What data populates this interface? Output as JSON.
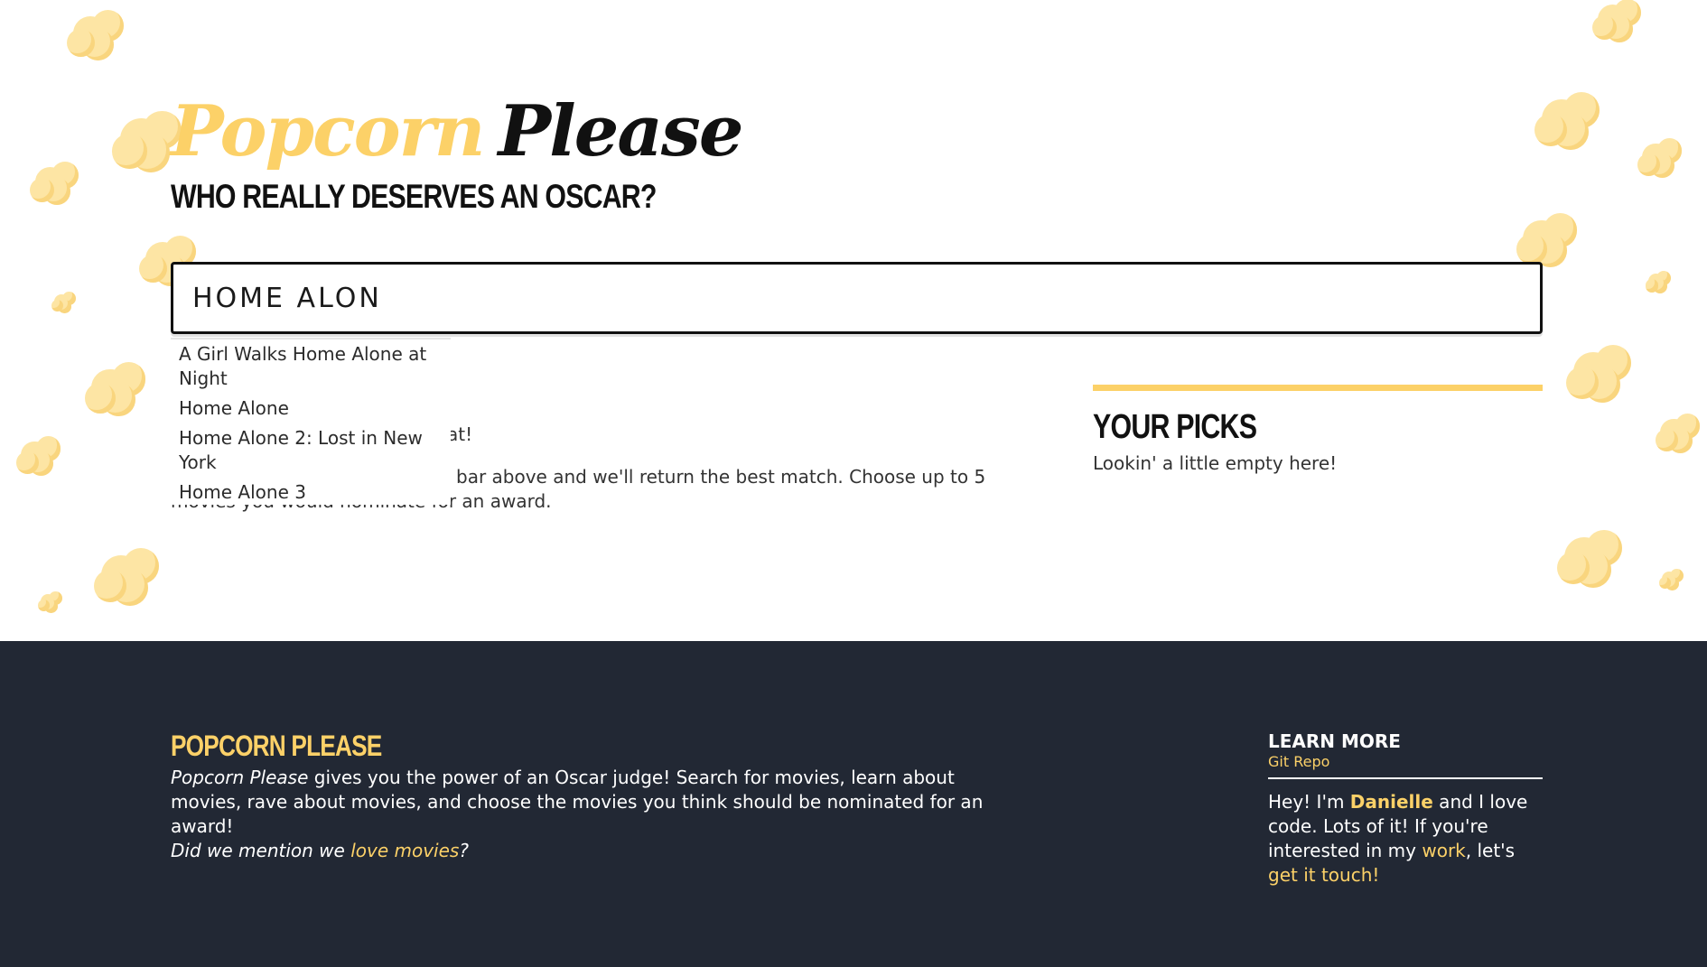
{
  "colors": {
    "accent": "#fcd168",
    "text_dark": "#111111",
    "footer_bg": "#222834",
    "popcorn": "#fde5a4"
  },
  "header": {
    "logo_part1": "Popcorn",
    "logo_part2": "Please",
    "tagline": "WHO REALLY DESERVES AN OSCAR?"
  },
  "search": {
    "value": "HOME ALON",
    "icon": "popcorn-icon"
  },
  "autocomplete": {
    "items": [
      "A Girl Walks Home Alone at Night",
      "Home Alone",
      "Home Alone 2: Lost in New York",
      "Home Alone 3"
    ]
  },
  "intro": {
    "heading_visible": "at!",
    "body_visible": "bar above and we'll return the best match. Choose up to 5 movies you would nominate for an award."
  },
  "picks": {
    "title": "YOUR PICKS",
    "empty_message": "Lookin' a little empty here!"
  },
  "footer": {
    "title": "POPCORN PLEASE",
    "desc_em": "Popcorn Please",
    "desc_text": " gives you the power of an Oscar judge! Search for movies, learn about movies, rave about movies, and choose the movies you think should be nominated for an award!",
    "mention_text": "Did we mention we ",
    "mention_link": "love movies",
    "mention_end": "?",
    "learn_more": "LEARN MORE",
    "git_link": "Git Repo",
    "about_1": "Hey! I'm ",
    "about_name": "Danielle",
    "about_2": " and I love code. Lots of it! If you're interested in my ",
    "about_work": "work",
    "about_3": ", let's ",
    "about_contact": "get it touch!"
  }
}
